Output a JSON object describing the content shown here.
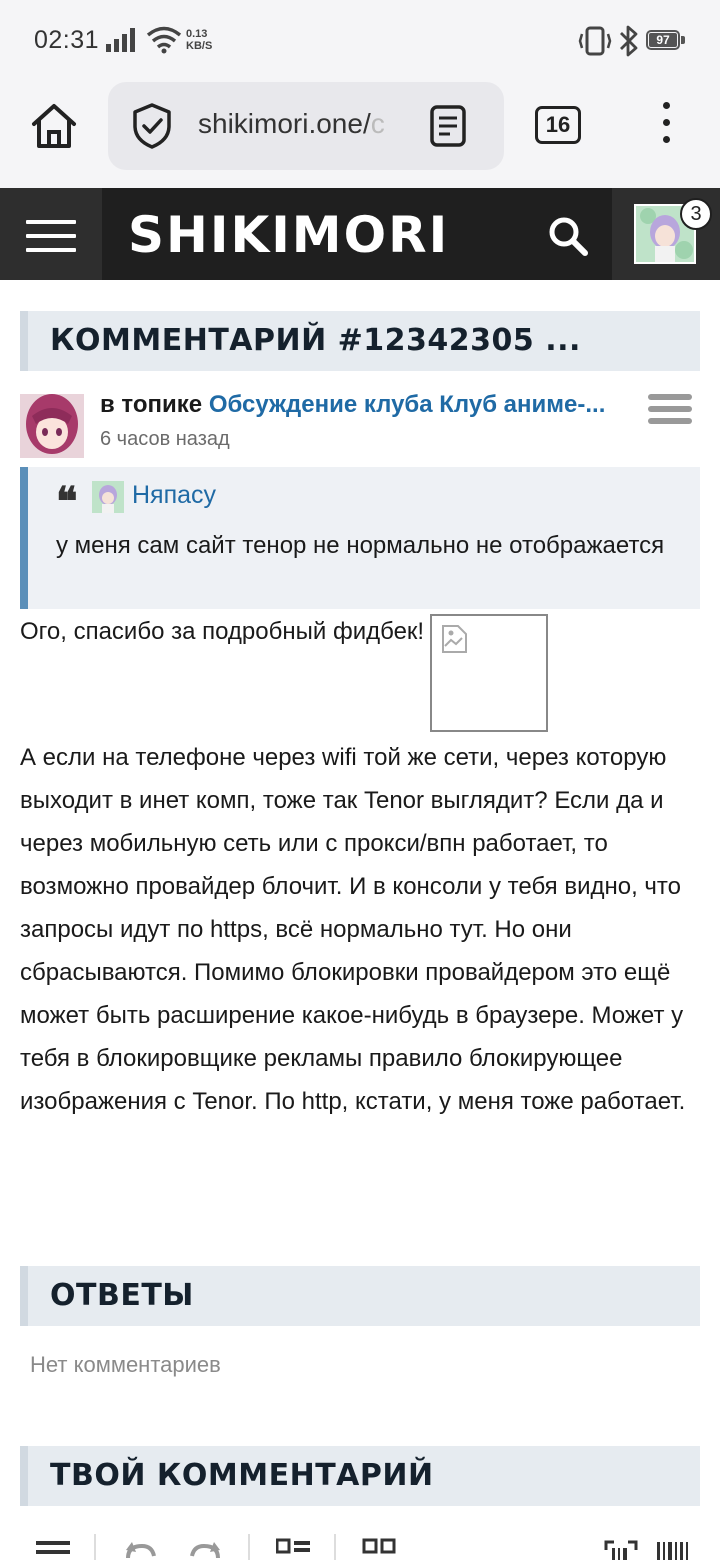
{
  "status_bar": {
    "time": "02:31",
    "speed_value": "0.13",
    "speed_unit": "KB/S",
    "battery": "97"
  },
  "browser": {
    "url_visible": "shikimori.one/",
    "url_fade": "c",
    "tab_count": "16"
  },
  "site": {
    "logo": "SHIKIMORI",
    "notification_count": "3"
  },
  "comment_section": {
    "title": "КОММЕНТАРИЙ #12342305 ..."
  },
  "comment": {
    "in_topic_label": "в топике",
    "topic_link": "Обсуждение клуба Клуб аниме-...",
    "time_ago": "6 часов назад",
    "quote": {
      "author": "Няпасу",
      "text": "у меня сам сайт тенор не нормально не отображается"
    },
    "body_first": "Ого, спасибо за подробный фидбек!",
    "body_second": "А если на телефоне через wifi той же сети, через которую выходит в инет комп, тоже так Tenor выглядит? Если да и через мобильную сеть или с прокси/впн работает, то возможно провайдер блочит. И в консоли у тебя видно, что запросы идут по https, всё нормально тут. Но они сбрасываются. Помимо блокировки провайдером это ещё может быть расширение какое-нибудь в браузере. Может у тебя в блокировщике рекламы правило блокирующее изображения с Tenor. По http, кстати, у меня тоже работает."
  },
  "replies_section": {
    "title": "ОТВЕТЫ",
    "empty_text": "Нет комментариев"
  },
  "your_comment_section": {
    "title": "ТВОЙ КОММЕНТАРИЙ"
  },
  "colors": {
    "header_bg": "#1f1f1f",
    "link": "#1f6aa5",
    "quote_border": "#5b8fb9",
    "section_bg": "#e6ebf0"
  }
}
